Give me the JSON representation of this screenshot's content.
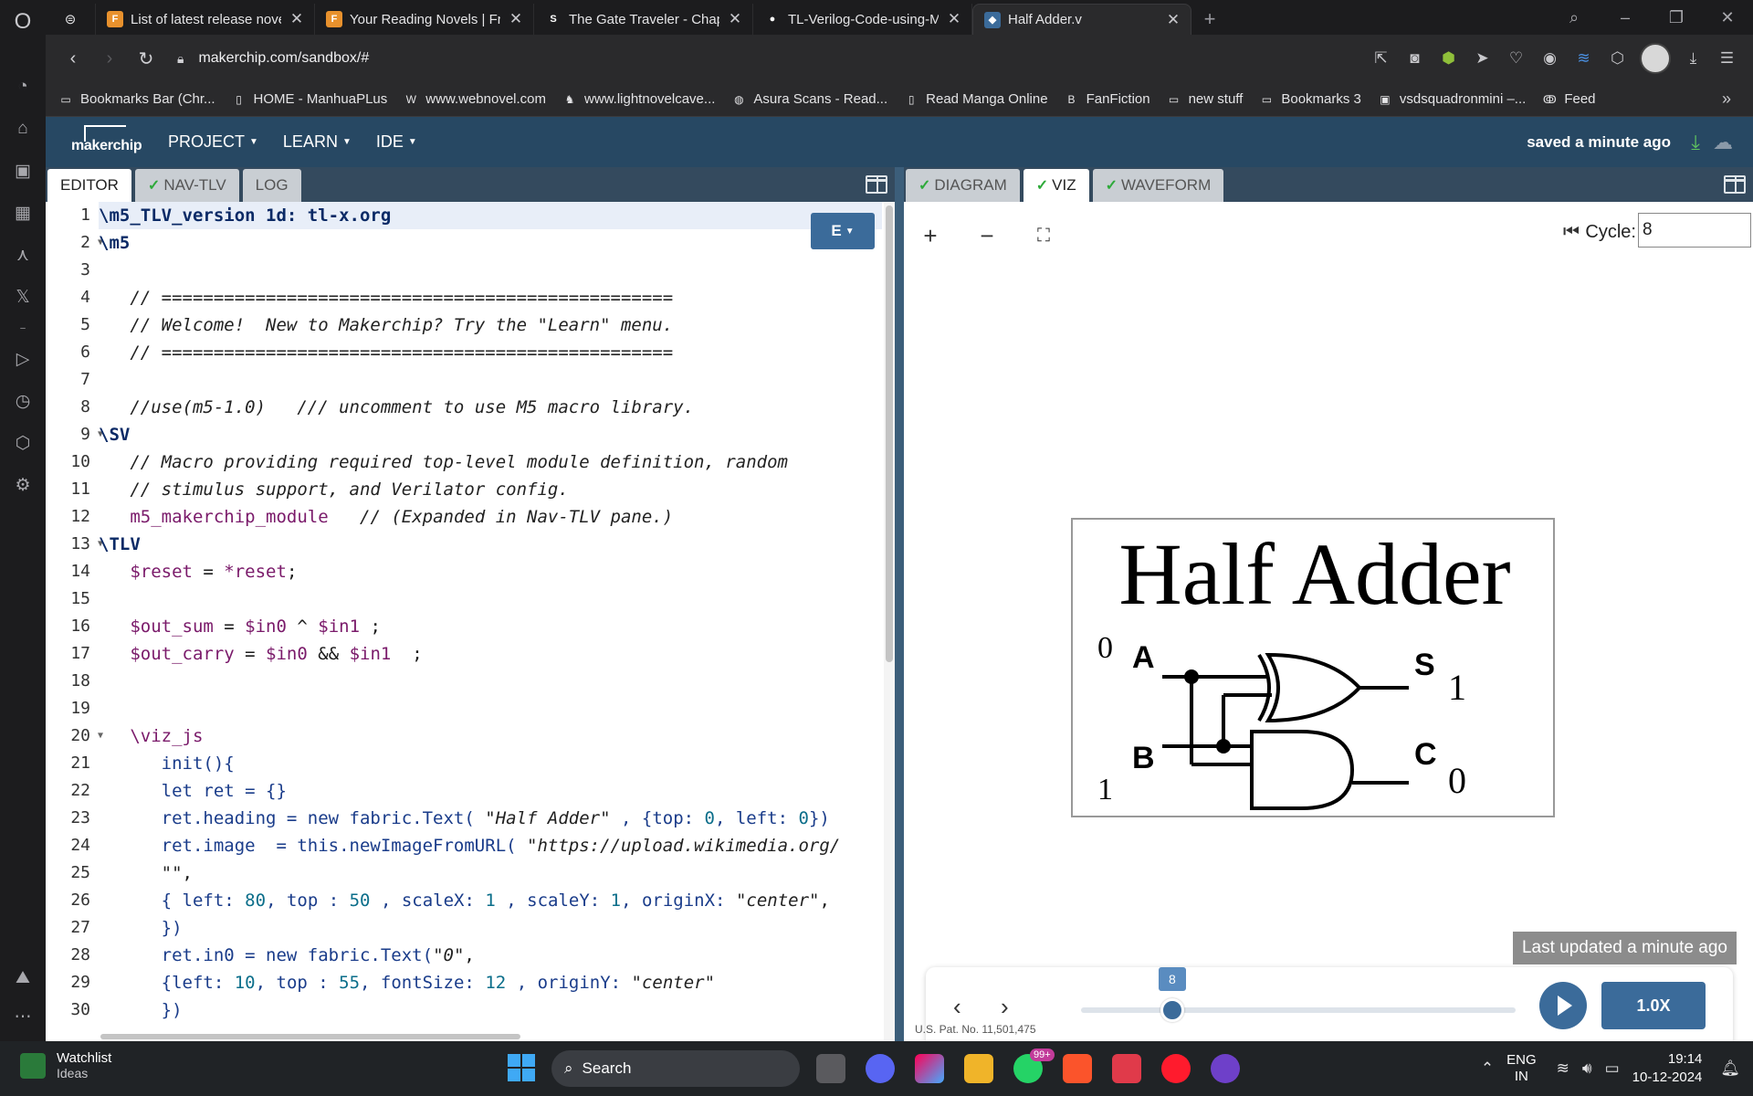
{
  "browser": {
    "tabs": [
      {
        "title": "List of latest release novels",
        "favicon_color": "#e8912d",
        "favicon_text": "F"
      },
      {
        "title": "Your Reading Novels | Free",
        "favicon_color": "#e8912d",
        "favicon_text": "F"
      },
      {
        "title": "The Gate Traveler - Chapter",
        "favicon_color": "#1c1c1e",
        "favicon_text": "S"
      },
      {
        "title": "TL-Verilog-Code-using-Mak",
        "favicon_color": "#1c1c1e",
        "favicon_text": "●"
      },
      {
        "title": "Half Adder.v",
        "favicon_color": "#3b6b9a",
        "favicon_text": "◆",
        "active": true
      }
    ],
    "url": "makerchip.com/sandbox/#",
    "bookmarks": [
      {
        "label": "Bookmarks Bar (Chr...",
        "icon": "folder-icon"
      },
      {
        "label": "HOME - ManhuaPLus",
        "icon": "page-icon"
      },
      {
        "label": "www.webnovel.com",
        "icon": "webnovel-icon"
      },
      {
        "label": "www.lightnovelcave...",
        "icon": "lightnovel-icon"
      },
      {
        "label": "Asura Scans - Read...",
        "icon": "asura-icon"
      },
      {
        "label": "Read Manga Online",
        "icon": "page-icon"
      },
      {
        "label": "FanFiction",
        "icon": "fanfiction-icon"
      },
      {
        "label": "new stuff",
        "icon": "folder-icon"
      },
      {
        "label": "Bookmarks 3",
        "icon": "folder-icon"
      },
      {
        "label": "vsdsquadronmini –...",
        "icon": "vsd-icon"
      },
      {
        "label": "Feed",
        "icon": "feed-icon"
      }
    ]
  },
  "makerchip": {
    "logo": "makerchip",
    "menu": [
      {
        "label": "PROJECT"
      },
      {
        "label": "LEARN"
      },
      {
        "label": "IDE"
      }
    ],
    "status": "saved a minute ago",
    "left_tabs": [
      {
        "label": "EDITOR",
        "active": true,
        "check": false
      },
      {
        "label": "NAV-TLV",
        "active": false,
        "check": true
      },
      {
        "label": "LOG",
        "active": false,
        "check": false
      }
    ],
    "right_tabs": [
      {
        "label": "DIAGRAM",
        "active": false,
        "check": true
      },
      {
        "label": "VIZ",
        "active": true,
        "check": true
      },
      {
        "label": "WAVEFORM",
        "active": false,
        "check": true
      }
    ],
    "editor_button": "E",
    "code_lines": [
      {
        "n": "1",
        "fold": false,
        "html": "<span class=\"c-kw\">\\m5_TLV_version 1d: tl-x.org</span>"
      },
      {
        "n": "2",
        "fold": true,
        "html": "<span class=\"c-kw\">\\m5</span>"
      },
      {
        "n": "3",
        "fold": false,
        "html": ""
      },
      {
        "n": "4",
        "fold": false,
        "html": "   <span class=\"c-cm\">// =================================================</span>"
      },
      {
        "n": "5",
        "fold": false,
        "html": "   <span class=\"c-cm\">// Welcome!  New to Makerchip? Try the \"Learn\" menu.</span>"
      },
      {
        "n": "6",
        "fold": false,
        "html": "   <span class=\"c-cm\">// =================================================</span>"
      },
      {
        "n": "7",
        "fold": false,
        "html": ""
      },
      {
        "n": "8",
        "fold": false,
        "html": "   <span class=\"c-cm\">//use(m5-1.0)   /// uncomment to use M5 macro library.</span>"
      },
      {
        "n": "9",
        "fold": true,
        "html": "<span class=\"c-kw\">\\SV</span>"
      },
      {
        "n": "10",
        "fold": false,
        "html": "   <span class=\"c-cm\">// Macro providing required top-level module definition, random</span>"
      },
      {
        "n": "11",
        "fold": false,
        "html": "   <span class=\"c-cm\">// stimulus support, and Verilator config.</span>"
      },
      {
        "n": "12",
        "fold": false,
        "html": "   <span class=\"c-var\">m5_makerchip_module</span>   <span class=\"c-cm\">// (Expanded in Nav-TLV pane.)</span>"
      },
      {
        "n": "13",
        "fold": true,
        "html": "<span class=\"c-kw\">\\TLV</span>"
      },
      {
        "n": "14",
        "fold": false,
        "html": "   <span class=\"c-var\">$reset</span> = <span class=\"c-var\">*reset</span>;"
      },
      {
        "n": "15",
        "fold": false,
        "html": ""
      },
      {
        "n": "16",
        "fold": false,
        "html": "   <span class=\"c-var\">$out_sum</span> = <span class=\"c-var\">$in0</span> ^ <span class=\"c-var\">$in1</span> ;"
      },
      {
        "n": "17",
        "fold": false,
        "html": "   <span class=\"c-var\">$out_carry</span> = <span class=\"c-var\">$in0</span> &amp;&amp; <span class=\"c-var\">$in1</span>  ;"
      },
      {
        "n": "18",
        "fold": false,
        "html": ""
      },
      {
        "n": "19",
        "fold": false,
        "html": ""
      },
      {
        "n": "20",
        "fold": true,
        "html": "   <span class=\"c-var\">\\viz_js</span>"
      },
      {
        "n": "21",
        "fold": false,
        "html": "      <span class=\"c-blue\">init(){</span>"
      },
      {
        "n": "22",
        "fold": false,
        "html": "      <span class=\"c-blue\">let ret = {}</span>"
      },
      {
        "n": "23",
        "fold": false,
        "html": "      <span class=\"c-blue\">ret.heading = new fabric.Text(</span> <span class=\"c-str\">\"Half Adder\"</span> <span class=\"c-blue\">, {top:</span> <span class=\"c-num\">0</span><span class=\"c-blue\">, left:</span> <span class=\"c-num\">0</span><span class=\"c-blue\">})</span>"
      },
      {
        "n": "24",
        "fold": false,
        "html": "      <span class=\"c-blue\">ret.image  = this.newImageFromURL(</span> <span class=\"c-str\">\"https://upload.wikimedia.org/</span>"
      },
      {
        "n": "25",
        "fold": false,
        "html": "      <span class=\"c-str\">\"\"</span>,"
      },
      {
        "n": "26",
        "fold": false,
        "html": "      <span class=\"c-blue\">{ left:</span> <span class=\"c-num\">80</span><span class=\"c-blue\">, top :</span> <span class=\"c-num\">50</span> <span class=\"c-blue\">, scaleX:</span> <span class=\"c-num\">1</span> <span class=\"c-blue\">, scaleY:</span> <span class=\"c-num\">1</span><span class=\"c-blue\">, originX:</span> <span class=\"c-str\">\"center\"</span>,"
      },
      {
        "n": "27",
        "fold": false,
        "html": "      <span class=\"c-blue\">})</span>"
      },
      {
        "n": "28",
        "fold": false,
        "html": "      <span class=\"c-blue\">ret.in0 = new fabric.Text(</span><span class=\"c-str\">\"0\"</span>,"
      },
      {
        "n": "29",
        "fold": false,
        "html": "      <span class=\"c-blue\">{left:</span> <span class=\"c-num\">10</span><span class=\"c-blue\">, top :</span> <span class=\"c-num\">55</span><span class=\"c-blue\">, fontSize:</span> <span class=\"c-num\">12</span> <span class=\"c-blue\">, originY:</span> <span class=\"c-str\">\"center\"</span>"
      },
      {
        "n": "30",
        "fold": false,
        "html": "      <span class=\"c-blue\">})</span>"
      }
    ],
    "viz": {
      "cycle_label": "Cycle:",
      "cycle_value": "8",
      "heading": "Half Adder",
      "in0": "0",
      "in1": "1",
      "label_a": "A",
      "label_b": "B",
      "label_s": "S",
      "label_c": "C",
      "out_sum": "1",
      "out_carry": "0",
      "last_updated": "Last updated a minute ago",
      "slider_value": "8",
      "slider_fraction": 0.21,
      "speed": "1.0X",
      "patent": "U.S. Pat. No. 11,501,475"
    }
  },
  "taskbar": {
    "watchlist_title": "Watchlist",
    "watchlist_sub": "Ideas",
    "search": "Search",
    "whatsapp_badge": "99+",
    "lang1": "ENG",
    "lang2": "IN",
    "time": "19:14",
    "date": "10-12-2024"
  }
}
